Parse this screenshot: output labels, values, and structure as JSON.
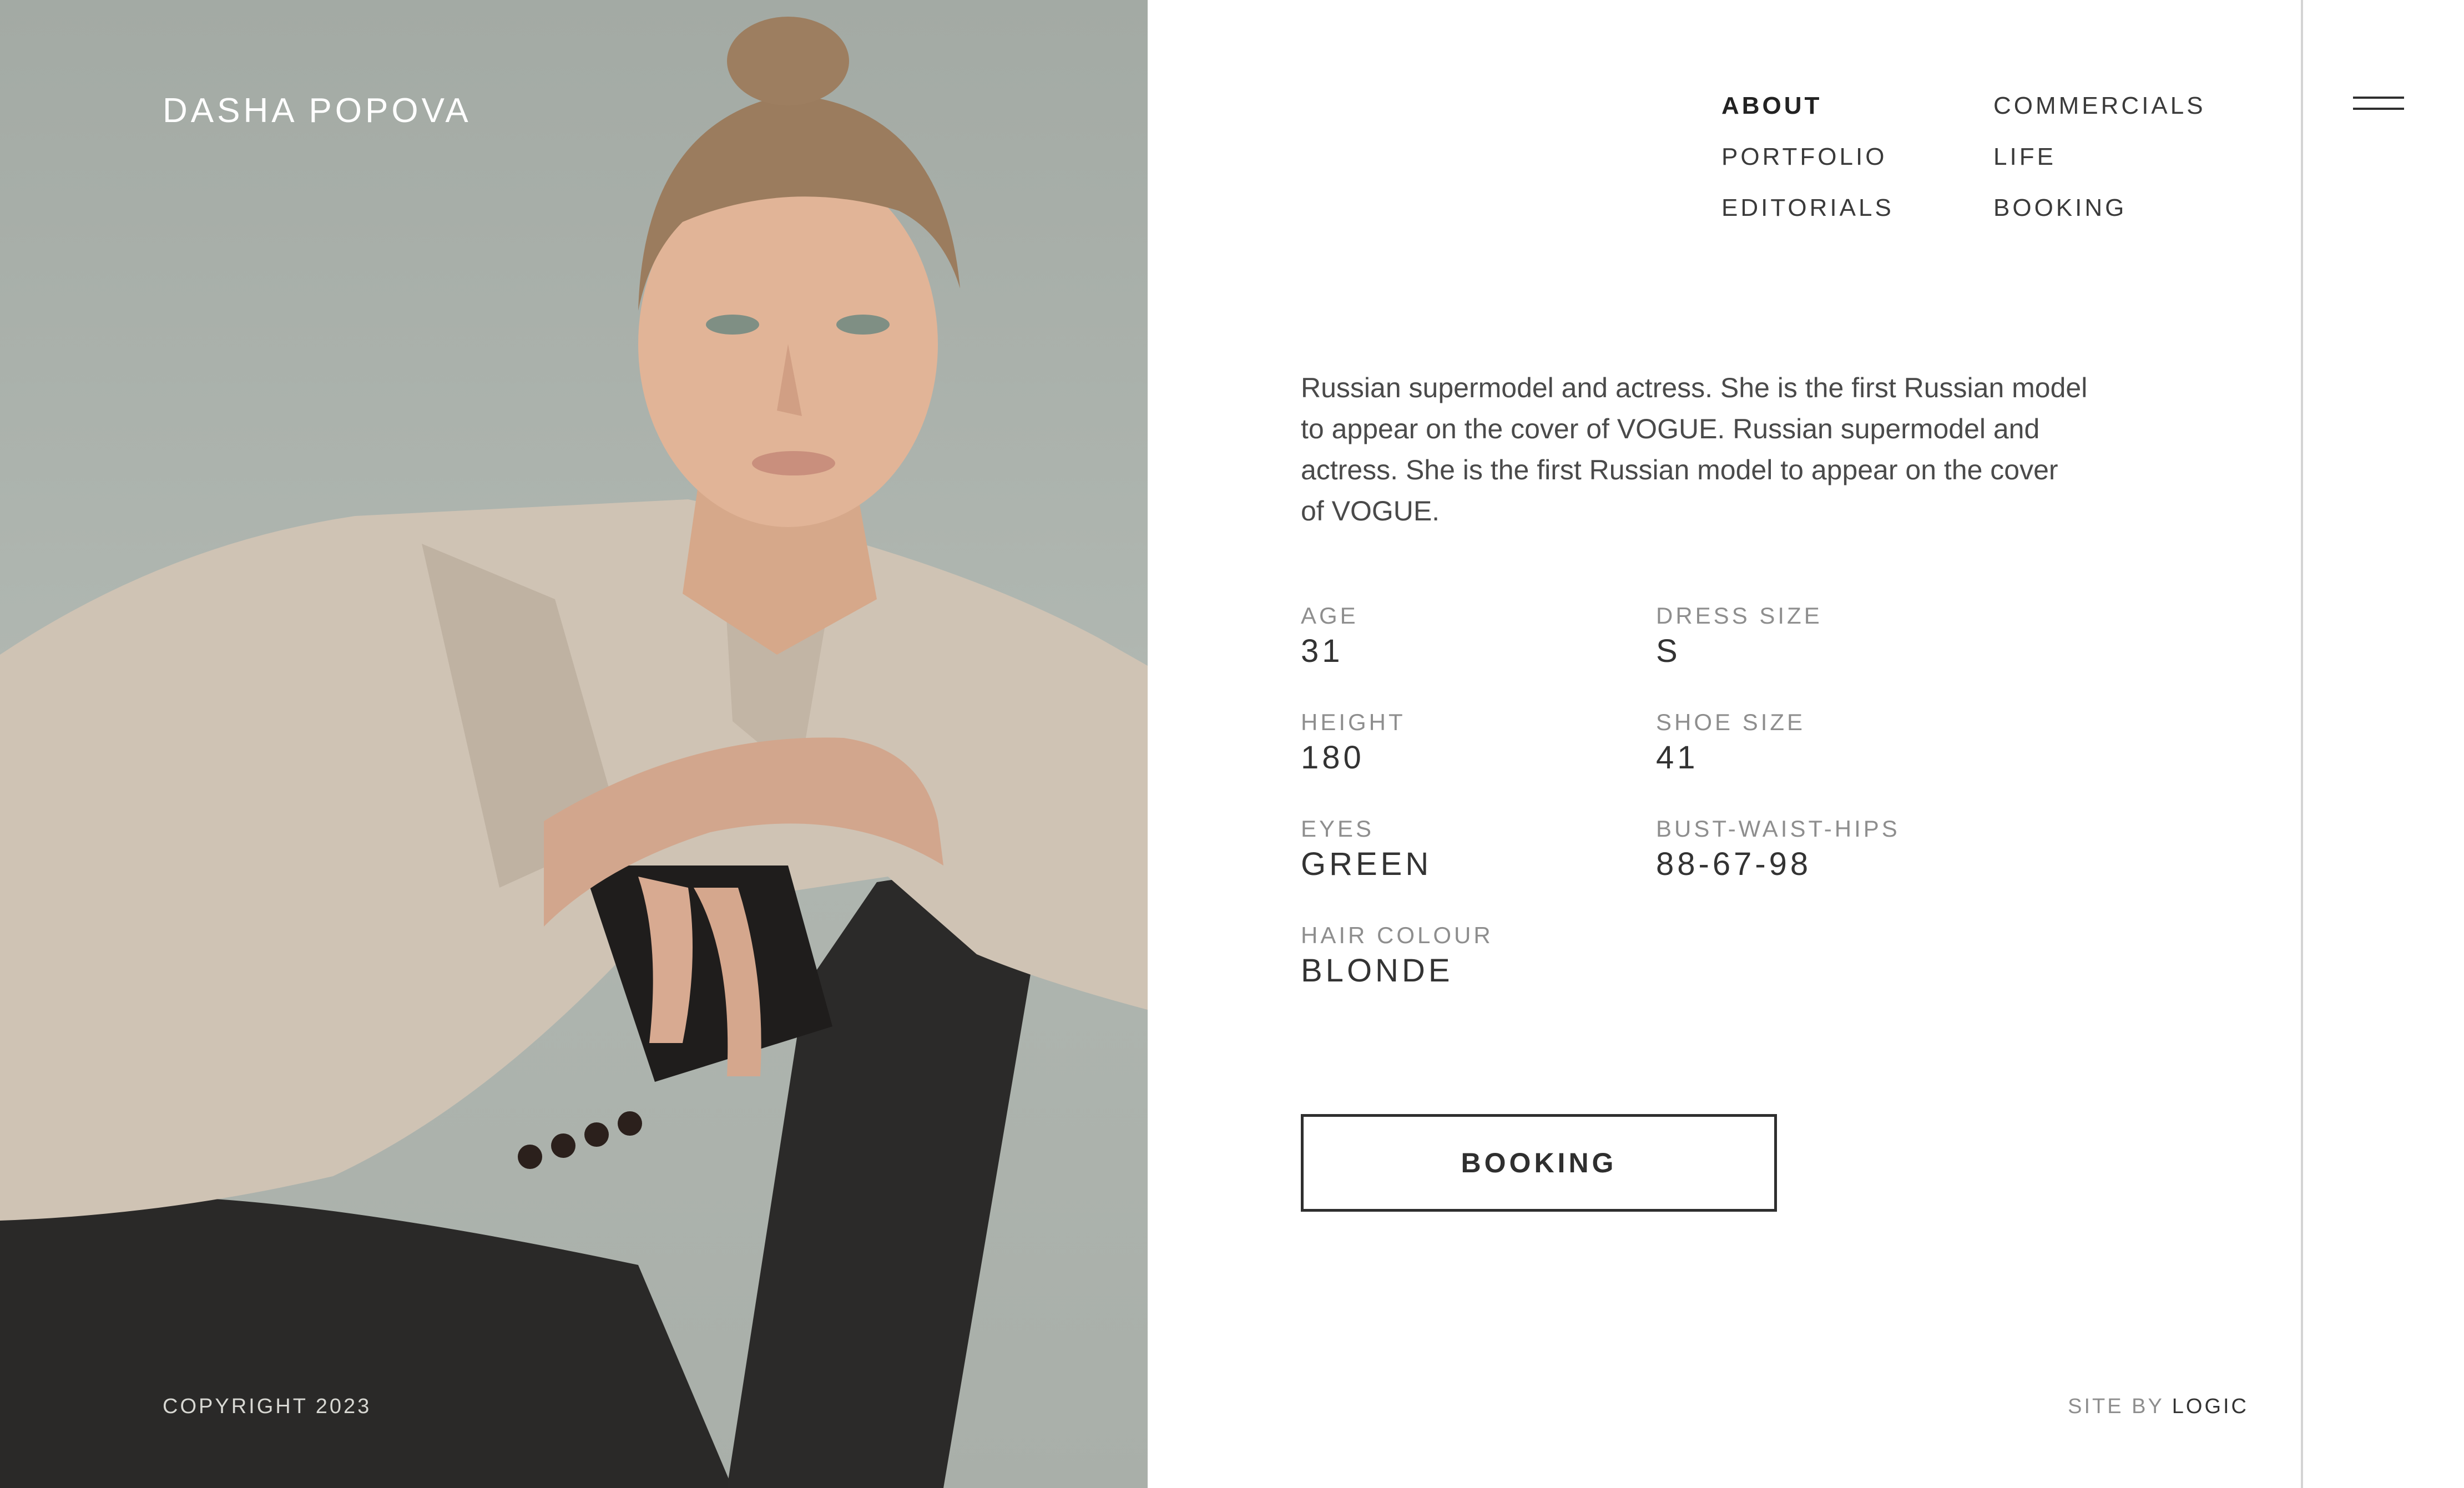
{
  "brand": {
    "name": "DASHA POPOVA"
  },
  "footer": {
    "copyright": "COPYRIGHT 2023",
    "site_by_prefix": "SITE BY",
    "site_by_name": "LOGIC"
  },
  "nav": {
    "items": [
      {
        "label": "ABOUT",
        "active": true
      },
      {
        "label": "COMMERCIALS"
      },
      {
        "label": "PORTFOLIO"
      },
      {
        "label": "LIFE"
      },
      {
        "label": "EDITORIALS"
      },
      {
        "label": "BOOKING"
      }
    ]
  },
  "bio": "Russian supermodel and actress. She is the first Russian model to appear on the cover of VOGUE. Russian supermodel and actress. She is the first Russian model to appear on the cover of VOGUE.",
  "stats": [
    {
      "label": "AGE",
      "value": "31"
    },
    {
      "label": "DRESS SIZE",
      "value": "S"
    },
    {
      "label": "HEIGHT",
      "value": "180"
    },
    {
      "label": "SHOE SIZE",
      "value": "41"
    },
    {
      "label": "EYES",
      "value": "GREEN"
    },
    {
      "label": "BUST-WAIST-HIPS",
      "value": "88-67-98"
    },
    {
      "label": "HAIR COLOUR",
      "value": "BLONDE"
    }
  ],
  "cta": {
    "booking_label": "BOOKING"
  },
  "icons": {
    "menu": "hamburger-menu-icon"
  },
  "colors": {
    "accent": "#2f2f2f",
    "photo_bg": "#a9afa9",
    "divider": "#d4d4d4"
  }
}
